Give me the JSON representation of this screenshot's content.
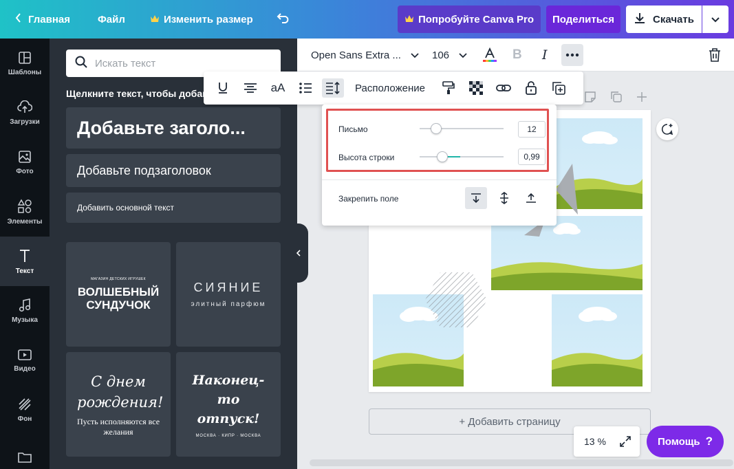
{
  "topbar": {
    "home": "Главная",
    "file": "Файл",
    "resize": "Изменить размер",
    "try_pro": "Попробуйте Canva Pro",
    "share": "Поделиться",
    "download": "Скачать"
  },
  "rail": [
    {
      "label": "Шаблоны",
      "icon": "templates-icon"
    },
    {
      "label": "Загрузки",
      "icon": "upload-icon"
    },
    {
      "label": "Фото",
      "icon": "photo-icon"
    },
    {
      "label": "Элементы",
      "icon": "elements-icon"
    },
    {
      "label": "Текст",
      "icon": "text-icon"
    },
    {
      "label": "Музыка",
      "icon": "music-icon"
    },
    {
      "label": "Видео",
      "icon": "video-icon"
    },
    {
      "label": "Фон",
      "icon": "background-icon"
    }
  ],
  "panel": {
    "search_placeholder": "Искать текст",
    "hint": "Щелкните текст, чтобы добавить его на страницу",
    "add_heading": "Добавьте заголо...",
    "add_subheading": "Добавьте подзаголовок",
    "add_body": "Добавить основной текст",
    "tiles": [
      {
        "small": "МАГАЗИН ДЕТСКИХ ИГРУШЕК",
        "main": "ВОЛШЕБНЫЙ СУНДУЧОК"
      },
      {
        "main": "СИЯНИЕ",
        "small": "элитный парфюм"
      },
      {
        "main": "С днем рождения!",
        "small": "Пусть исполняются все желания"
      },
      {
        "main": "Наконец-то отпуск!",
        "small": "МОСКВА · КИПР · МОСКВА"
      }
    ]
  },
  "editor": {
    "font": "Open Sans Extra ...",
    "size": "106",
    "bold": "B",
    "italic": "I"
  },
  "float_toolbar": {
    "case": "aA",
    "position": "Расположение"
  },
  "spacing": {
    "letter_label": "Письмо",
    "letter_value": "12",
    "letter_level": 0.2,
    "line_label": "Высота строки",
    "line_value": "0,99",
    "line_level": 0.27,
    "anchor_label": "Закрепить поле"
  },
  "canvas": {
    "add_page": "+ Добавить страницу",
    "zoom": "13 %"
  },
  "help": {
    "label": "Помощь",
    "mark": "?"
  },
  "colors": {
    "accent": "#7d2ae8",
    "highlight": "#e05151",
    "slider_active": "#1fb5a8"
  }
}
